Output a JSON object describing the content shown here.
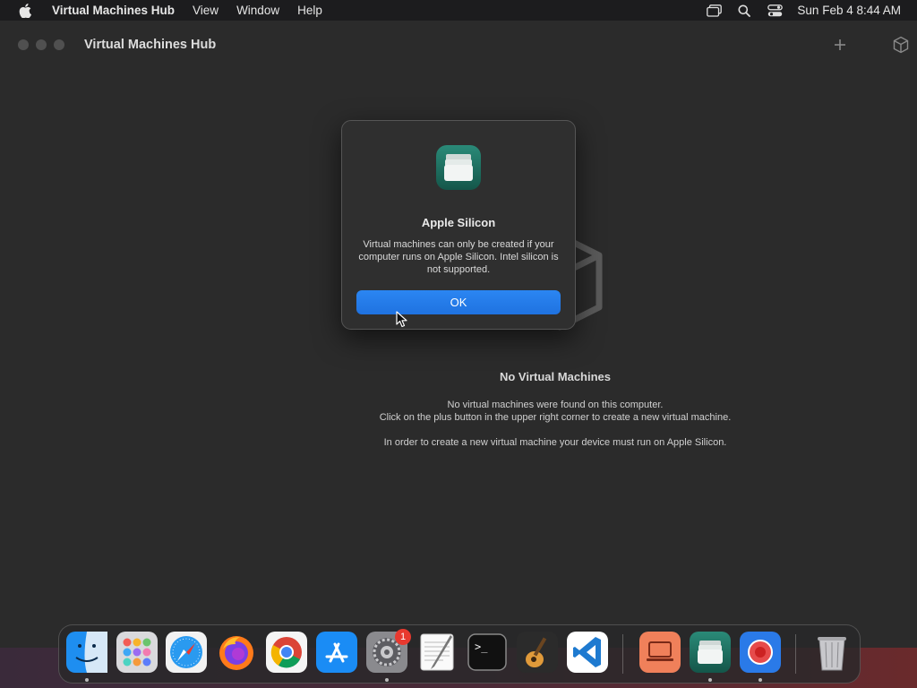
{
  "menubar": {
    "app_name": "Virtual Machines Hub",
    "items": [
      "View",
      "Window",
      "Help"
    ],
    "clock": "Sun Feb 4  8:44 AM"
  },
  "window": {
    "title": "Virtual Machines Hub"
  },
  "empty_state": {
    "title": "No Virtual Machines",
    "line1": "No virtual machines were found on this computer.",
    "line2": "Click on the plus button in the upper right corner to create a new virtual machine.",
    "line3": "In order to create a new virtual machine your device must run on Apple Silicon."
  },
  "dialog": {
    "title": "Apple Silicon",
    "message": "Virtual machines can only be created if your computer runs on Apple Silicon. Intel silicon is not supported.",
    "ok_label": "OK"
  },
  "dock": {
    "apps": [
      "finder",
      "launchpad",
      "safari",
      "firefox",
      "chrome",
      "app-store",
      "system-settings",
      "textedit",
      "terminal",
      "garageband",
      "vscode",
      "remote-desktop",
      "virtual-machines-hub",
      "screen-recorder",
      "trash"
    ],
    "settings_badge": "1"
  },
  "colors": {
    "accent": "#1f72e0",
    "background": "#2b2b2b",
    "dialog_bg": "#2f2f2f"
  }
}
